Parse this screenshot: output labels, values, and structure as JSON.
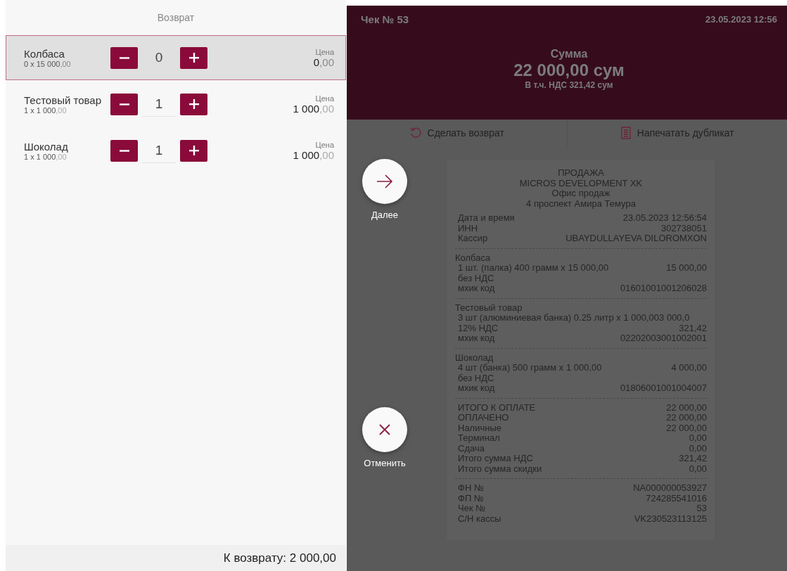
{
  "return_panel": {
    "title": "Возврат",
    "items": [
      {
        "name": "Колбаса",
        "qty_line": "0 x 15 000",
        "qty_decimals": ",00",
        "quantity": "0",
        "price_label": "Цена",
        "price": "0",
        "price_decimals": ",00",
        "selected": true
      },
      {
        "name": "Тестовый товар",
        "qty_line": "1 x 1 000",
        "qty_decimals": ",00",
        "quantity": "1",
        "price_label": "Цена",
        "price": "1 000",
        "price_decimals": ",00",
        "selected": false
      },
      {
        "name": "Шоколад",
        "qty_line": "1 x 1 000",
        "qty_decimals": ",00",
        "quantity": "1",
        "price_label": "Цена",
        "price": "1 000",
        "price_decimals": ",00",
        "selected": false
      }
    ],
    "total": "К возврату: 2 000,00"
  },
  "receipt_panel": {
    "check_number": "Чек № 53",
    "datetime": "23.05.2023 12:56",
    "sum_label": "Сумма",
    "sum": "22 000,00 сум",
    "vat_note": "В т.ч. НДС 321,42 сум",
    "actions": [
      {
        "label": "Сделать возврат",
        "kind": "return"
      },
      {
        "label": "Напечатать дубликат",
        "kind": "print"
      }
    ],
    "receipt": {
      "header_lines": [
        "ПРОДАЖА",
        "MICROS DEVELOPMENT XK",
        "Офис продаж",
        "4 проспект Амира Темура"
      ],
      "sections": [
        [
          {
            "kind": "line",
            "label": "Дата и время",
            "value": "23.05.2023 12:56:54"
          },
          {
            "kind": "line",
            "label": "ИНН",
            "value": "302738051"
          },
          {
            "kind": "line",
            "label": "Кассир",
            "value": "UBAYDULLAYEVA DILOROMXON"
          }
        ],
        [
          {
            "kind": "name",
            "label": "Колбаса"
          },
          {
            "kind": "line",
            "label": "1 шт. (палка) 400 грамм x 15 000,00",
            "value": "15 000,00"
          },
          {
            "kind": "line",
            "label": "без НДС"
          },
          {
            "kind": "line",
            "label": "мхик код",
            "value": "01601001001206028"
          }
        ],
        [
          {
            "kind": "name",
            "label": "Тестовый товар"
          },
          {
            "kind": "line",
            "label": "3 шт (алюминиевая банка) 0.25 литр x 1 000,003 000,0"
          },
          {
            "kind": "line",
            "label": "12% НДС",
            "value": "321,42"
          },
          {
            "kind": "line",
            "label": "мхик код",
            "value": "02202003001002001"
          }
        ],
        [
          {
            "kind": "name",
            "label": "Шоколад"
          },
          {
            "kind": "line",
            "label": "4 шт (банка) 500 грамм x 1 000,00",
            "value": "4 000,00"
          },
          {
            "kind": "line",
            "label": "без НДС"
          },
          {
            "kind": "line",
            "label": "мхик код",
            "value": "01806001001004007"
          }
        ],
        [
          {
            "kind": "line",
            "label": "ИТОГО К ОПЛАТЕ",
            "value": "22 000,00"
          },
          {
            "kind": "line",
            "label": "ОПЛАЧЕНО",
            "value": "22 000,00"
          },
          {
            "kind": "line",
            "label": "Наличные",
            "value": "22 000,00"
          },
          {
            "kind": "line",
            "label": "Терминал",
            "value": "0,00"
          },
          {
            "kind": "line",
            "label": "Сдача",
            "value": "0,00"
          },
          {
            "kind": "line",
            "label": "Итого сумма НДС",
            "value": "321,42"
          },
          {
            "kind": "line",
            "label": "Итого сумма скидки",
            "value": "0,00"
          }
        ],
        [
          {
            "kind": "line",
            "label": "ФН №",
            "value": "NA000000053927"
          },
          {
            "kind": "line",
            "label": "ФП №",
            "value": "724285541016"
          },
          {
            "kind": "line",
            "label": "Чек №",
            "value": "53"
          },
          {
            "kind": "line",
            "label": "С/Н кассы",
            "value": "VK230523113125"
          }
        ]
      ]
    }
  },
  "fab_buttons": [
    {
      "label": "Далее",
      "kind": "next"
    },
    {
      "label": "Отменить",
      "kind": "cancel"
    }
  ]
}
